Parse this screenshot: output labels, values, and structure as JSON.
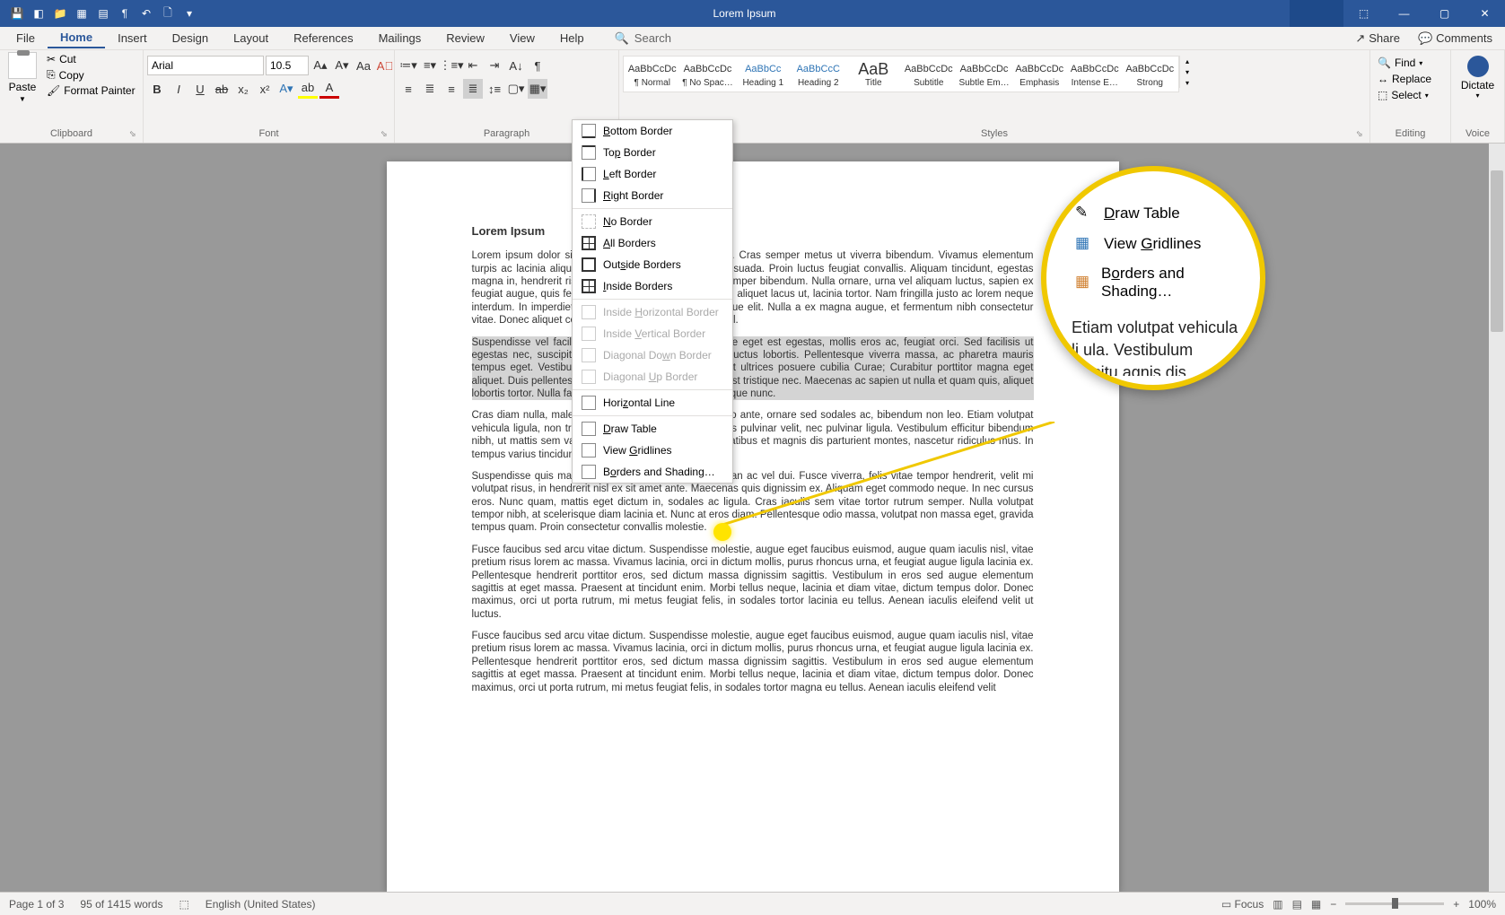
{
  "title": "Lorem Ipsum",
  "menu": [
    "File",
    "Home",
    "Insert",
    "Design",
    "Layout",
    "References",
    "Mailings",
    "Review",
    "View",
    "Help"
  ],
  "active_menu": 1,
  "search_placeholder": "Search",
  "share": "Share",
  "comments": "Comments",
  "clipboard": {
    "label": "Clipboard",
    "paste": "Paste",
    "cut": "Cut",
    "copy": "Copy",
    "fp": "Format Painter"
  },
  "font": {
    "label": "Font",
    "name": "Arial",
    "size": "10.5"
  },
  "para": {
    "label": "Paragraph"
  },
  "styles": {
    "label": "Styles",
    "items": [
      {
        "preview": "AaBbCcDc",
        "name": "¶ Normal"
      },
      {
        "preview": "AaBbCcDc",
        "name": "¶ No Spac…"
      },
      {
        "preview": "AaBbCc",
        "name": "Heading 1",
        "cls": "heading"
      },
      {
        "preview": "AaBbCcC",
        "name": "Heading 2",
        "cls": "heading"
      },
      {
        "preview": "AaB",
        "name": "Title",
        "cls": "title"
      },
      {
        "preview": "AaBbCcDc",
        "name": "Subtitle"
      },
      {
        "preview": "AaBbCcDc",
        "name": "Subtle Em…"
      },
      {
        "preview": "AaBbCcDc",
        "name": "Emphasis"
      },
      {
        "preview": "AaBbCcDc",
        "name": "Intense E…"
      },
      {
        "preview": "AaBbCcDc",
        "name": "Strong"
      }
    ]
  },
  "editing": {
    "label": "Editing",
    "find": "Find",
    "replace": "Replace",
    "select": "Select"
  },
  "voice": {
    "label": "Voice",
    "dictate": "Dictate"
  },
  "borders_menu": [
    {
      "label": "Bottom Border",
      "u": "B",
      "cls": "bottom"
    },
    {
      "label": "Top Border",
      "u": "P",
      "cls": "top",
      "pre": "To"
    },
    {
      "label": "Left Border",
      "u": "L",
      "cls": "left"
    },
    {
      "label": "Right Border",
      "u": "R",
      "cls": "right"
    },
    {
      "sep": true
    },
    {
      "label": "No Border",
      "u": "N",
      "cls": "none"
    },
    {
      "label": "All Borders",
      "u": "A",
      "cls": "all"
    },
    {
      "label": "Outside Borders",
      "u": "S",
      "cls": "outside",
      "pre": "Out"
    },
    {
      "label": "Inside Borders",
      "u": "I",
      "cls": "all"
    },
    {
      "sep": true
    },
    {
      "label": "Inside Horizontal Border",
      "u": "H",
      "pre": "Inside ",
      "disabled": true
    },
    {
      "label": "Inside Vertical Border",
      "u": "V",
      "pre": "Inside ",
      "disabled": true
    },
    {
      "label": "Diagonal Down Border",
      "u": "W",
      "pre": "Diagonal Do",
      "disabled": true
    },
    {
      "label": "Diagonal Up Border",
      "u": "U",
      "pre": "Diagonal ",
      "disabled": true
    },
    {
      "sep": true
    },
    {
      "label": "Horizontal Line",
      "u": "Z",
      "pre": "Hori"
    },
    {
      "sep": true
    },
    {
      "label": "Draw Table",
      "u": "D"
    },
    {
      "label": "View Gridlines",
      "u": "G",
      "pre": "View "
    },
    {
      "label": "Borders and Shading…",
      "u": "O",
      "pre": "B"
    }
  ],
  "callout": {
    "draw": "Draw Table",
    "grid": "View Gridlines",
    "bas": "Borders and Shading…",
    "text": "Etiam volutpat vehicula li\nula. Vestibulum efficitu\nagnis dis parturient"
  },
  "doc": {
    "heading": "Lorem Ipsum",
    "p1": "Lorem ipsum dolor sit amet, consectetur adipiscing elit. Cras semper metus ut viverra bibendum. Vivamus elementum turpis ac lacinia aliquet. Proin sed mi eu euismod malesuada. Proin luctus feugiat convallis. Aliquam tincidunt, egestas magna in, hendrerit risus. Vivamus cursus enim a elit semper bibendum. Nulla ornare, urna vel aliquam luctus, sapien ex feugiat augue, quis fermentum nisl. Cras ac nisl sodales, aliquet lacus ut, lacinia tortor. Nam fringilla justo ac lorem neque interdum. In imperdiet velit et velit suscipit aliquet tristique elit. Nulla a ex magna augue, et fermentum nibh consectetur vitae. Donec aliquet consectetur erat, sit amet lobortis nisl.",
    "p2": "Suspendisse vel facilisis finibus bibendum. Suspendisse eget est egestas, mollis eros ac, feugiat orci. Sed facilisis ut egestas nec, suscipit a nisl. Duis erat ex, finibus vel luctus lobortis. Pellentesque viverra massa, ac pharetra mauris tempus eget. Vestibulum ante ipsum primis in luctus et ultrices posuere cubilia Curae; Curabitur porttitor magna eget aliquet. Duis pellentesque laoreet mi, faucibus tincidunt est tristique nec. Maecenas ac sapien ut nulla et quam quis, aliquet lobortis tortor. Nulla facilisis rhoncus lacus, non pellentesque nunc.",
    "p3": "Cras diam nulla, malesuada eu tempus nunc. Nullam leo ante, ornare sed sodales ac, bibendum non leo. Etiam volutpat vehicula ligula, non tristique turpis blandit non. Nam quis pulvinar velit, nec pulvinar ligula. Vestibulum efficitur bibendum nibh, ut mattis sem varius nec. Orci varius natoque penatibus et magnis dis parturient montes, nascetur ridiculus mus. In tempus varius tincidunt.",
    "p4": "Suspendisse quis magna quis mauris maximus accumsan ac vel dui. Fusce viverra, felis vitae tempor hendrerit, velit mi volutpat risus, in hendrerit nisl ex sit amet ante. Maecenas quis dignissim ex. Aliquam eget commodo neque. In nec cursus eros. Nunc quam, mattis eget dictum in, sodales ac ligula. Cras iaculis sem vitae tortor rutrum semper. Nulla volutpat tempor nibh, at scelerisque diam lacinia et. Nunc at eros diam. Pellentesque odio massa, volutpat non massa eget, gravida tempus quam. Proin consectetur convallis molestie.",
    "p5": "Fusce faucibus sed arcu vitae dictum. Suspendisse molestie, augue eget faucibus euismod, augue quam iaculis nisl, vitae pretium risus lorem ac massa. Vivamus lacinia, orci in dictum mollis, purus rhoncus urna, et feugiat augue ligula lacinia ex. Pellentesque hendrerit porttitor eros, sed dictum massa dignissim sagittis. Vestibulum in eros sed augue elementum sagittis at eget massa. Praesent at tincidunt enim. Morbi tellus neque, lacinia et diam vitae, dictum tempus dolor. Donec maximus, orci ut porta rutrum, mi metus feugiat felis, in sodales tortor lacinia eu tellus. Aenean iaculis eleifend velit ut luctus.",
    "p6": "Fusce faucibus sed arcu vitae dictum. Suspendisse molestie, augue eget faucibus euismod, augue quam iaculis nisl, vitae pretium risus lorem ac massa. Vivamus lacinia, orci in dictum mollis, purus rhoncus urna, et feugiat augue ligula lacinia ex. Pellentesque hendrerit porttitor eros, sed dictum massa dignissim sagittis. Vestibulum in eros sed augue elementum sagittis at eget massa. Praesent at tincidunt enim. Morbi tellus neque, lacinia et diam vitae, dictum tempus dolor. Donec maximus, orci ut porta rutrum, mi metus feugiat felis, in sodales tortor magna eu tellus. Aenean iaculis eleifend velit"
  },
  "status": {
    "page": "Page 1 of 3",
    "words": "95 of 1415 words",
    "lang": "English (United States)",
    "focus": "Focus",
    "zoom": "100%"
  }
}
